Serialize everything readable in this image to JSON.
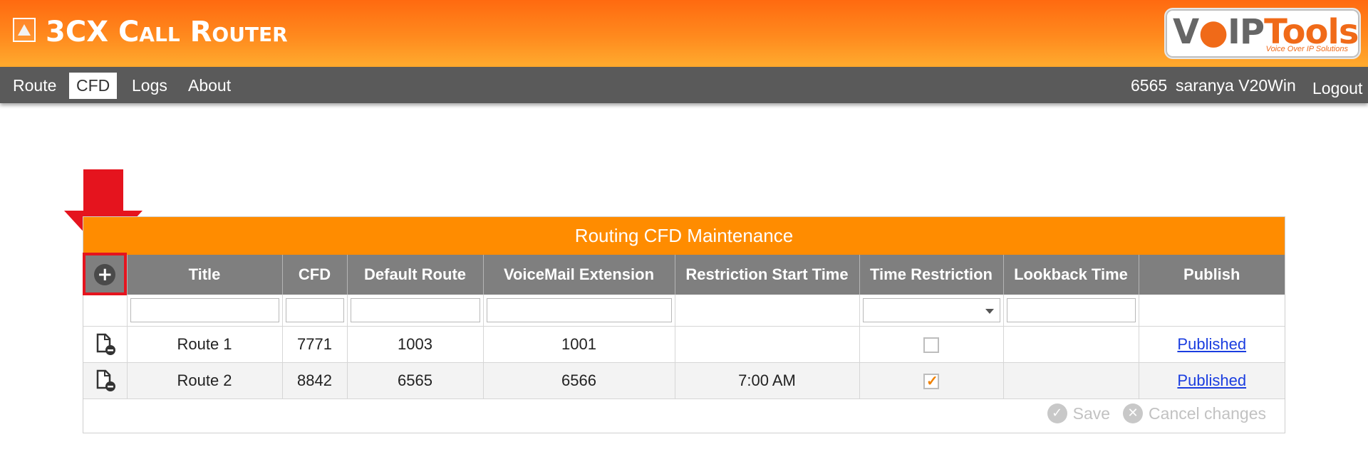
{
  "app": {
    "title": "3CX Call Router"
  },
  "logo": {
    "part1": "V",
    "part2": "IP",
    "part3": "Tools",
    "tagline": "Voice Over IP Solutions"
  },
  "nav": {
    "items": [
      {
        "label": "Route",
        "active": false
      },
      {
        "label": "CFD",
        "active": true
      },
      {
        "label": "Logs",
        "active": false
      },
      {
        "label": "About",
        "active": false
      }
    ],
    "user_ext": "6565",
    "user_name": "saranya V20Win",
    "logout": "Logout"
  },
  "grid": {
    "title": "Routing CFD Maintenance",
    "add_icon": "plus-circle-icon",
    "columns": [
      "Title",
      "CFD",
      "Default Route",
      "VoiceMail Extension",
      "Restriction Start Time",
      "Time Restriction",
      "Lookback Time",
      "Publish"
    ],
    "rows": [
      {
        "title": "Route 1",
        "cfd": "7771",
        "default_route": "1003",
        "voicemail": "1001",
        "start_time": "",
        "time_restriction": false,
        "lookback": "",
        "publish": "Published"
      },
      {
        "title": "Route 2",
        "cfd": "8842",
        "default_route": "6565",
        "voicemail": "6566",
        "start_time": "7:00 AM",
        "time_restriction": true,
        "lookback": "",
        "publish": "Published"
      }
    ],
    "save_label": "Save",
    "cancel_label": "Cancel changes"
  },
  "colors": {
    "header": "#ff7a18",
    "nav": "#5a5a5a",
    "grid_title": "#ff8c00",
    "grid_header": "#7f7f7f",
    "highlight": "#e5141e",
    "link": "#1a3de0"
  }
}
